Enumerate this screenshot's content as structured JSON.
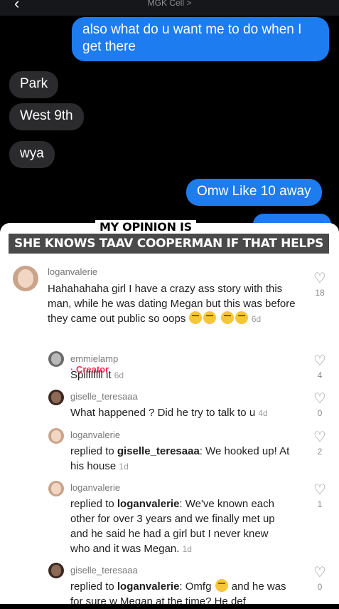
{
  "messages": {
    "contact": "MGK Cell >",
    "bubbles": [
      "also what do u want me to do when I get there",
      "Park",
      "West 9th",
      "wya",
      "Omw Like 10 away",
      ""
    ]
  },
  "overlay": {
    "line1": "MY OPINION IS",
    "line2": "SHE KNOWS TAAV COOPERMAN IF THAT HELPS"
  },
  "panel": {
    "close_label": "×",
    "comments": [
      {
        "username": "loganvalerie",
        "text": "Hahahahaha girl I have a crazy ass story with this man, while he was dating Megan but this was before they came out public so oops",
        "age": "6d",
        "likes": "18"
      },
      {
        "username": "emmielamp",
        "badge": "· Creator",
        "text": "SpillIllll it",
        "age": "6d",
        "likes": "4"
      },
      {
        "username": "giselle_teresaaa",
        "text": "What happened ? Did he try to talk to u",
        "age": "4d",
        "likes": "0"
      },
      {
        "username": "loganvalerie",
        "reply_prefix": "replied to ",
        "reply_to": "giselle_teresaaa",
        "text": ": We hooked up! At his house",
        "age": "1d",
        "likes": "2"
      },
      {
        "username": "loganvalerie",
        "reply_prefix": "replied to ",
        "reply_to": "loganvalerie",
        "text": ": We've known each other for over 3 years and we finally met up and he said he had a girl but I never knew who and it was Megan.",
        "age": "1d",
        "likes": "1"
      },
      {
        "username": "giselle_teresaaa",
        "reply_prefix": "replied to ",
        "reply_to": "loganvalerie",
        "text": ": Omfg",
        "text2": "and he was for sure w Megan at the time? He def",
        "likes": "0"
      }
    ]
  },
  "icons": {
    "heart": "heart-outline-icon",
    "emoji": "flushed-face-emoji"
  },
  "colors": {
    "outgoing_bubble": "#1c7cf0",
    "incoming_bubble": "#2b2b2d",
    "creator_badge": "#fe2c55"
  }
}
